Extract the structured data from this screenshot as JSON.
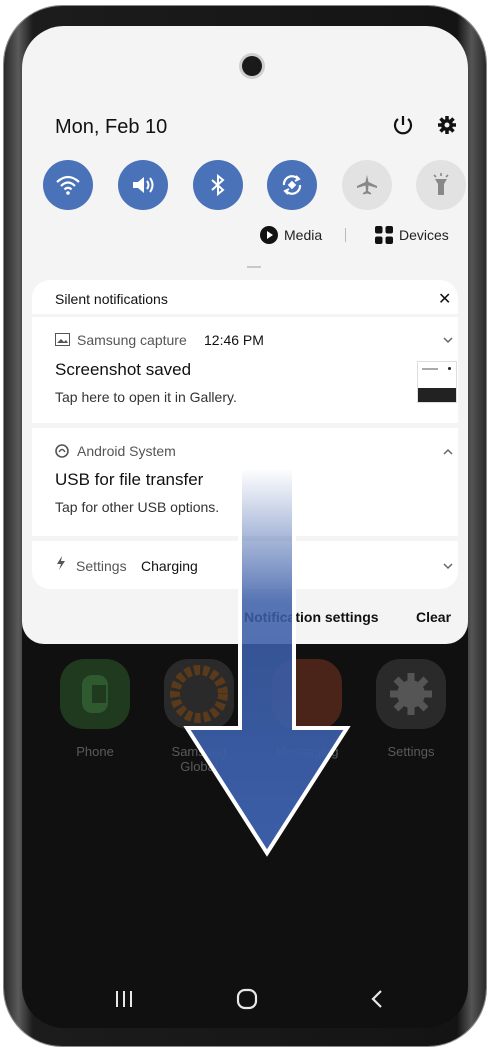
{
  "status": {
    "date": "Mon, Feb 10"
  },
  "quick_settings": [
    {
      "icon": "wifi-icon",
      "state": "on"
    },
    {
      "icon": "sound-icon",
      "state": "on"
    },
    {
      "icon": "bluetooth-icon",
      "state": "on"
    },
    {
      "icon": "auto-rotate-icon",
      "state": "on"
    },
    {
      "icon": "airplane-icon",
      "state": "off"
    },
    {
      "icon": "flashlight-icon",
      "state": "off"
    }
  ],
  "panel_controls": {
    "media_label": "Media",
    "devices_label": "Devices"
  },
  "notifications": {
    "section_title": "Silent notifications",
    "dismiss_glyph": "✕",
    "items": [
      {
        "app": "Samsung capture",
        "time": "12:46 PM",
        "title": "Screenshot saved",
        "body": "Tap here to open it in Gallery."
      },
      {
        "app": "Android System",
        "title": "USB for file transfer",
        "body": "Tap for other USB options."
      },
      {
        "app": "Settings",
        "title": "Charging"
      }
    ],
    "footer": {
      "settings_label": "Notification settings",
      "clear_label": "Clear"
    }
  },
  "home_apps": [
    {
      "label": "Phone"
    },
    {
      "label": "Samsung Global"
    },
    {
      "label": "Messaging"
    },
    {
      "label": "Settings"
    }
  ],
  "colors": {
    "accent": "#4a72b8",
    "arrow": "#3b5ea8"
  }
}
